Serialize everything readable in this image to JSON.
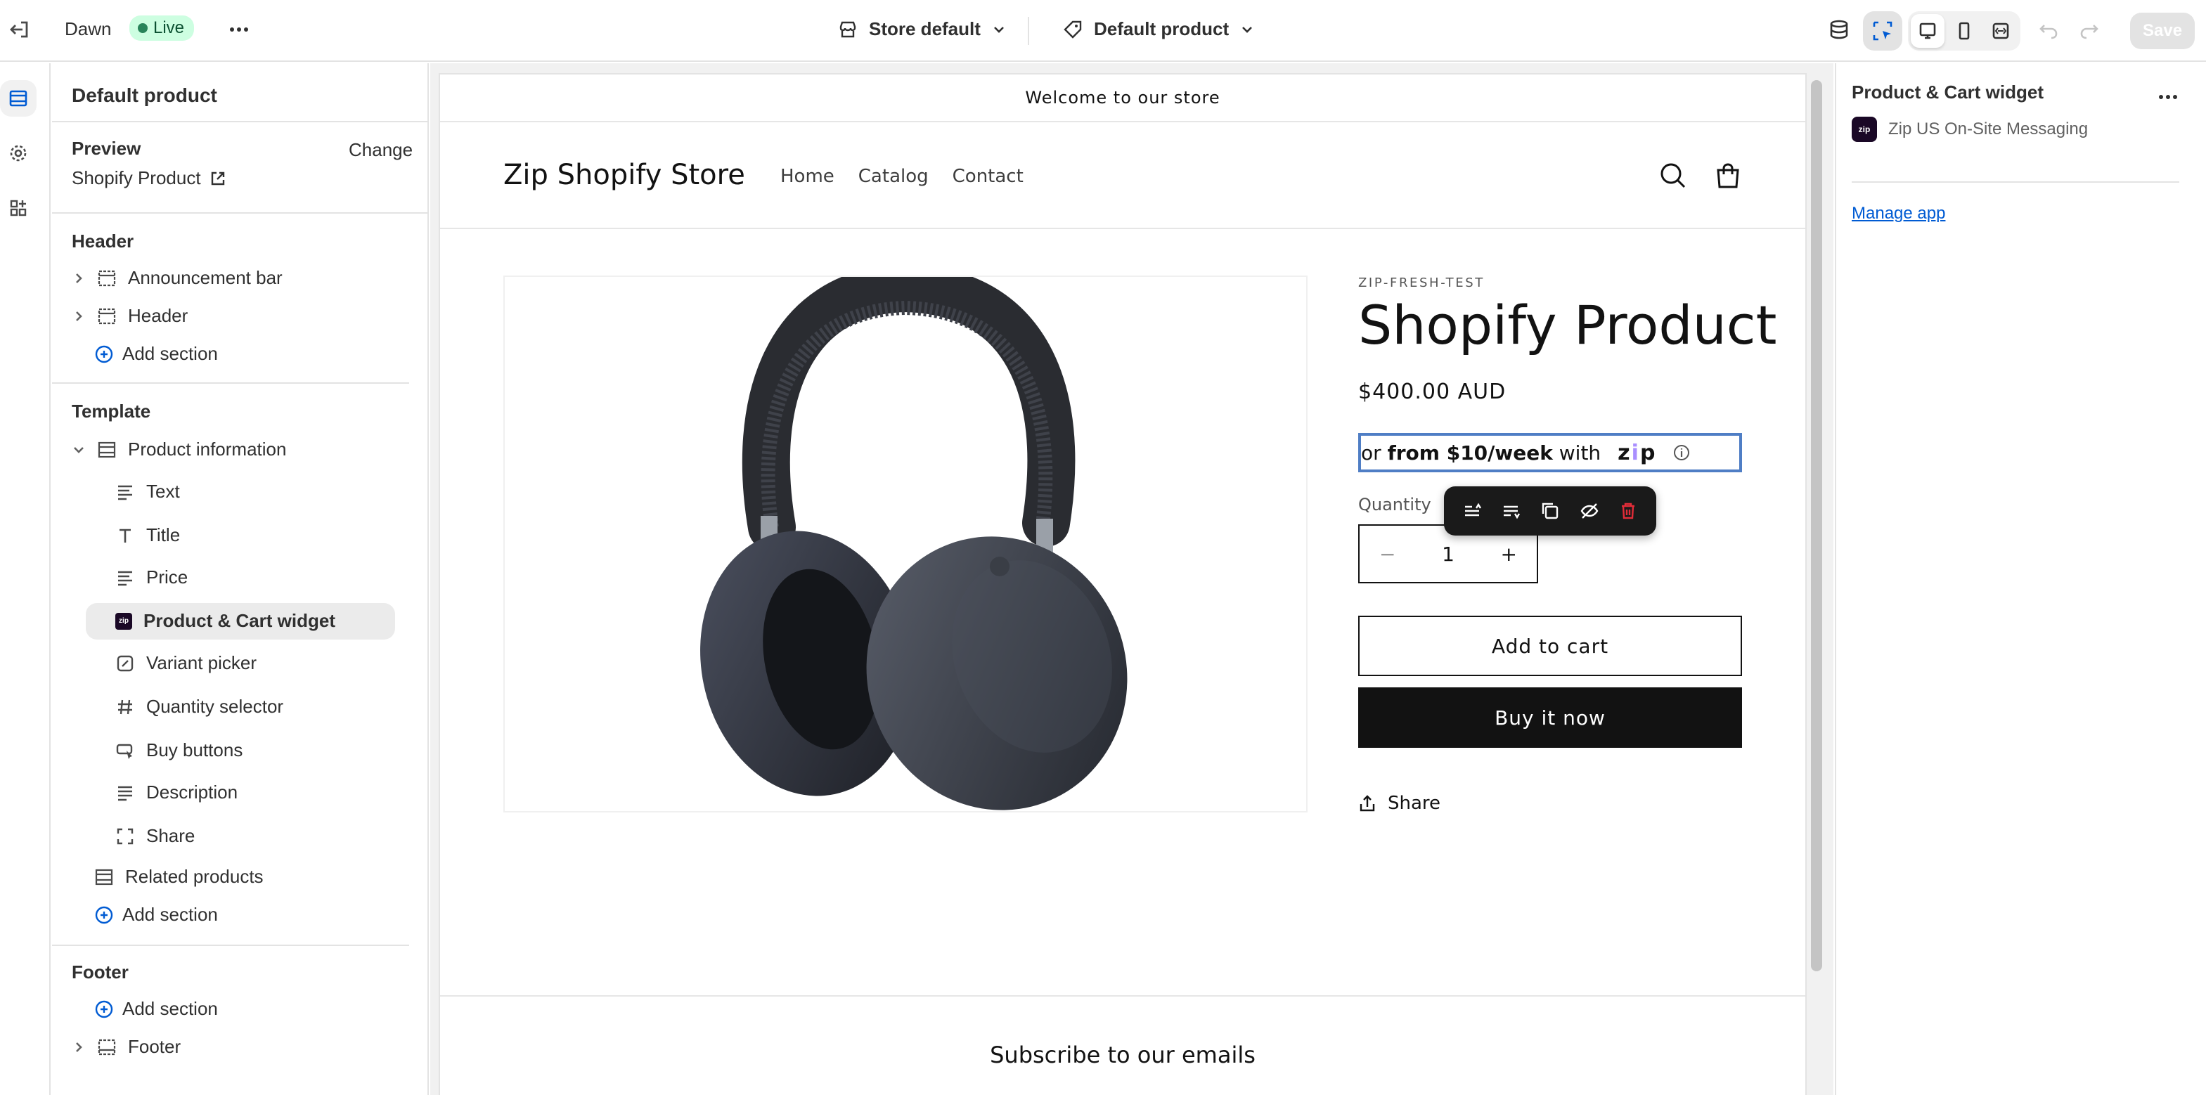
{
  "topbar": {
    "theme_name": "Dawn",
    "live_label": "Live",
    "store_selector": "Store default",
    "template_selector": "Default product",
    "save_label": "Save"
  },
  "left_panel": {
    "title": "Default product",
    "preview_label": "Preview",
    "change_label": "Change",
    "preview_product": "Shopify Product",
    "header_group": "Header",
    "header_items": [
      "Announcement bar",
      "Header"
    ],
    "add_section": "Add section",
    "template_group": "Template",
    "product_information": "Product information",
    "blocks": [
      "Text",
      "Title",
      "Price",
      "Product & Cart widget",
      "Variant picker",
      "Quantity selector",
      "Buy buttons",
      "Description",
      "Share"
    ],
    "related_products": "Related products",
    "footer_group": "Footer",
    "footer_item": "Footer"
  },
  "preview": {
    "announcement": "Welcome to our store",
    "store_name": "Zip Shopify Store",
    "nav": [
      "Home",
      "Catalog",
      "Contact"
    ],
    "vendor": "ZIP-FRESH-TEST",
    "product_title": "Shopify Product",
    "price": "$400.00 AUD",
    "zip_or": "or",
    "zip_amount": "from $10/week",
    "zip_with": "with",
    "zip_logo": "zip",
    "quantity_label": "Quantity",
    "quantity_value": "1",
    "minus": "−",
    "plus": "+",
    "add_to_cart": "Add to cart",
    "buy_now": "Buy it now",
    "share": "Share",
    "subscribe": "Subscribe to our emails"
  },
  "right_panel": {
    "title": "Product & Cart widget",
    "app_name": "Zip US On-Site Messaging",
    "manage_app": "Manage app"
  },
  "colors": {
    "accent_blue": "#005bd3",
    "live_badge_bg": "#cdfee1",
    "zip_purple": "#aa8fff",
    "dark": "#121212"
  }
}
